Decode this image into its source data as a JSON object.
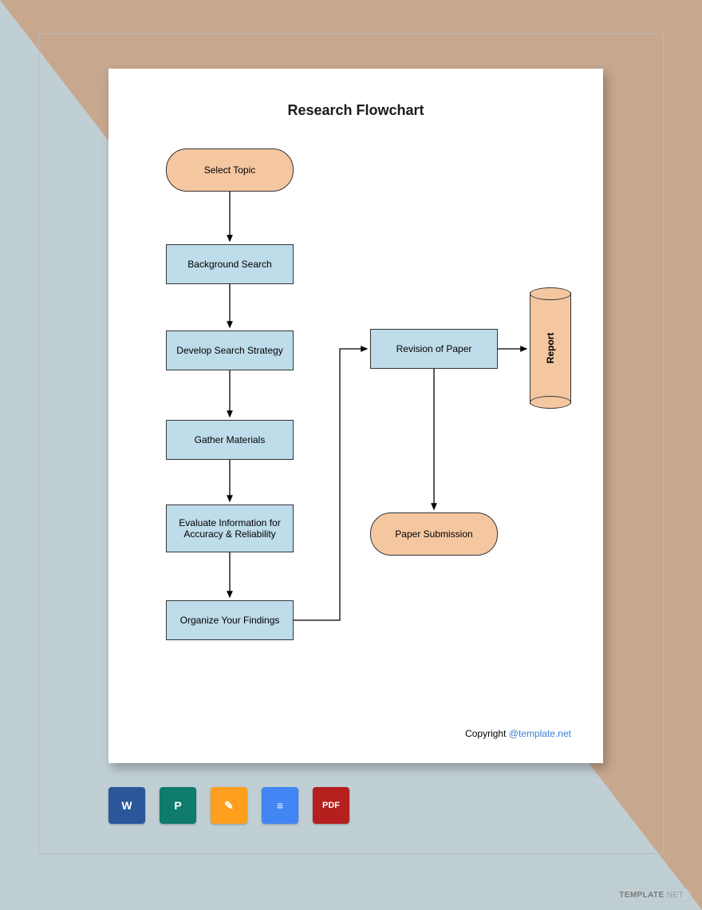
{
  "title": "Research Flowchart",
  "nodes": {
    "select_topic": "Select Topic",
    "background_search": "Background Search",
    "develop_strategy": "Develop Search Strategy",
    "gather_materials": "Gather Materials",
    "evaluate_info": "Evaluate Information for Accuracy & Reliability",
    "organize_findings": "Organize Your Findings",
    "revision": "Revision of Paper",
    "submission": "Paper Submission",
    "report": "Report"
  },
  "copyright": {
    "label": "Copyright ",
    "link": "@template.net"
  },
  "icons": {
    "word": "W",
    "publisher": "P",
    "pages": "✎",
    "gdoc": "≡",
    "pdf": "PDF"
  },
  "watermark": {
    "a": "TEMPLATE",
    "b": ".NET"
  }
}
